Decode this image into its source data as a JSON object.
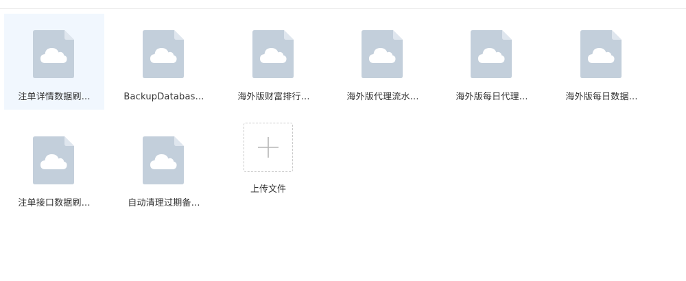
{
  "files": [
    {
      "name": "注单详情数据刷...",
      "selected": true
    },
    {
      "name": "BackupDatabas...",
      "selected": false
    },
    {
      "name": "海外版财富排行...",
      "selected": false
    },
    {
      "name": "海外版代理流水...",
      "selected": false
    },
    {
      "name": "海外版每日代理...",
      "selected": false
    },
    {
      "name": "海外版每日数据...",
      "selected": false
    },
    {
      "name": "注单接口数据刷...",
      "selected": false
    },
    {
      "name": "自动清理过期备...",
      "selected": false
    }
  ],
  "upload": {
    "label": "上传文件",
    "icon": "plus-icon"
  },
  "file_icon": "cloud-file-icon",
  "colors": {
    "file_icon": "#c3cfdb",
    "cloud": "#ffffff",
    "selected_bg": "#f1f7fe",
    "plus": "#b5b5b5"
  }
}
